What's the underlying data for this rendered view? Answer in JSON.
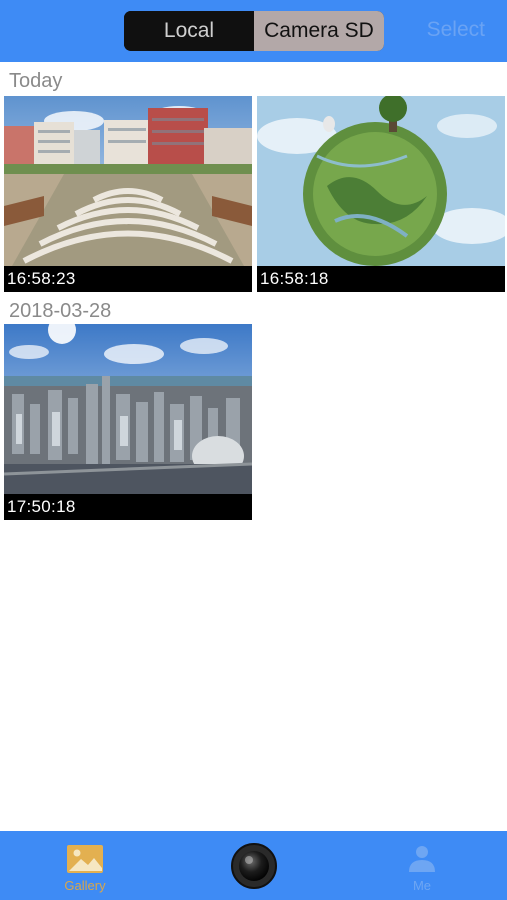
{
  "header": {
    "segments": [
      "Local",
      "Camera SD"
    ],
    "selected_segment": "Camera SD",
    "select_label": "Select"
  },
  "sections": [
    {
      "label": "Today",
      "items": [
        {
          "time": "16:58:23",
          "thumbnail": "panorama-plaza-image"
        },
        {
          "time": "16:58:18",
          "thumbnail": "little-planet-image"
        }
      ]
    },
    {
      "label": "2018-03-28",
      "items": [
        {
          "time": "17:50:18",
          "thumbnail": "city-aerial-image"
        }
      ]
    }
  ],
  "tabbar": {
    "gallery_label": "Gallery",
    "me_label": "Me",
    "active_tab": "Gallery",
    "icons": {
      "gallery": "gallery-icon",
      "camera": "camera-shutter-icon",
      "me": "person-icon"
    }
  },
  "colors": {
    "bar": "#3e8bf5",
    "active_tab": "#d9a64a",
    "segment_selected": "#b3a8a8"
  }
}
